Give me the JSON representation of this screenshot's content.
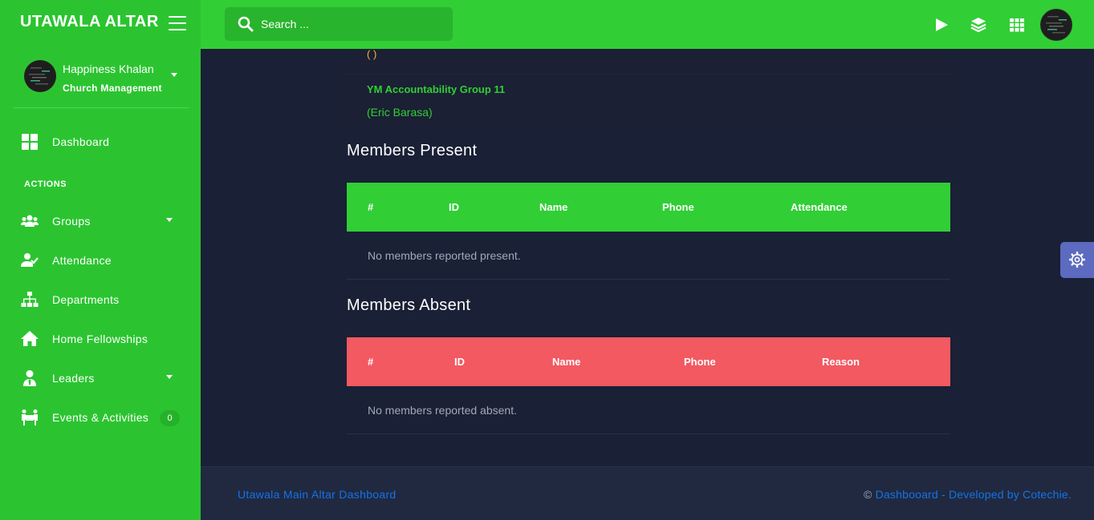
{
  "brand": {
    "name": "UTAWALA ALTAR"
  },
  "search": {
    "placeholder": "Search ..."
  },
  "user": {
    "name": "Happiness Khalan",
    "role": "Church Management"
  },
  "sidebar": {
    "section_heading": "ACTIONS",
    "items": [
      {
        "label": "Dashboard",
        "icon": "dashboard-icon"
      },
      {
        "label": "Groups",
        "icon": "users-icon",
        "has_dropdown": true
      },
      {
        "label": "Attendance",
        "icon": "user-check-icon"
      },
      {
        "label": "Departments",
        "icon": "sitemap-icon"
      },
      {
        "label": "Home Fellowships",
        "icon": "home-icon"
      },
      {
        "label": "Leaders",
        "icon": "user-tie-icon",
        "has_dropdown": true
      },
      {
        "label": "Events & Activities",
        "icon": "people-carry-icon",
        "badge": "0"
      }
    ]
  },
  "group_card": {
    "previous_leader": "( )",
    "title": "YM Accountability Group 11",
    "leader": "(Eric Barasa)"
  },
  "present": {
    "title": "Members Present",
    "columns": [
      "#",
      "ID",
      "Name",
      "Phone",
      "Attendance"
    ],
    "empty": "No members reported present."
  },
  "absent": {
    "title": "Members Absent",
    "columns": [
      "#",
      "ID",
      "Name",
      "Phone",
      "Reason"
    ],
    "empty": "No members reported absent."
  },
  "footer": {
    "left": "Utawala Main Altar Dashboard",
    "right_prefix": "© ",
    "right_link": "Dashbooard - Developed by Cotechie."
  },
  "colors": {
    "topbar": "#31ce36",
    "sidebar": "#2bc430",
    "content_bg": "#1a2035",
    "present_header": "#31ce36",
    "absent_header": "#f25961",
    "link": "#1572e8",
    "settings": "#5c6bc0"
  }
}
